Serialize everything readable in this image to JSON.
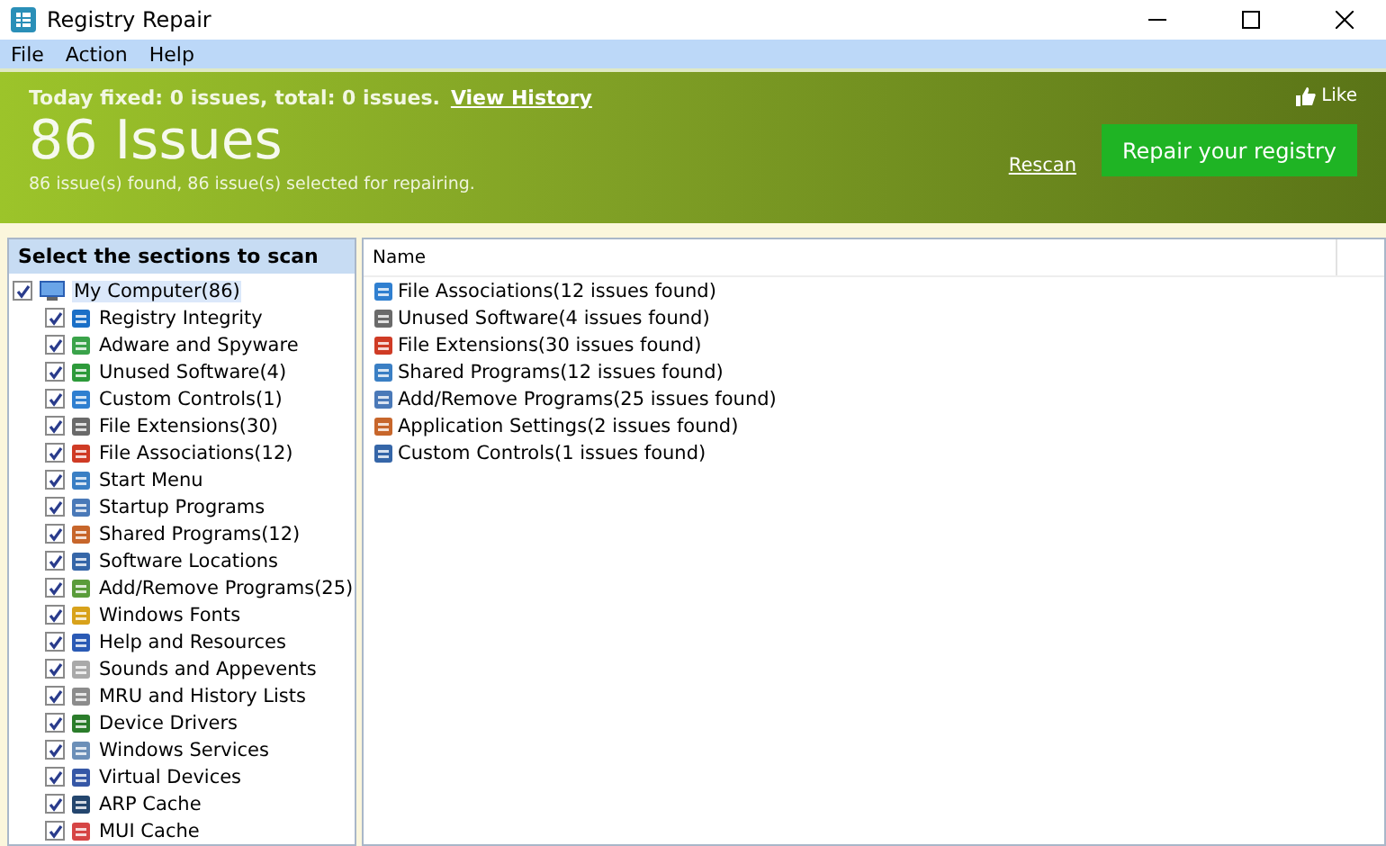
{
  "window": {
    "title": "Registry Repair"
  },
  "menu": [
    "File",
    "Action",
    "Help"
  ],
  "banner": {
    "today": "Today fixed: 0 issues, total: 0 issues.",
    "history_link": "View History",
    "headline": "86 Issues",
    "summary": "86 issue(s) found, 86 issue(s) selected for repairing.",
    "like": "Like",
    "rescan": "Rescan",
    "repair_button": "Repair your registry"
  },
  "sections": {
    "title": "Select the sections to scan",
    "tree": [
      {
        "label": "My Computer(86)",
        "checked": true,
        "selected": true,
        "children": [
          {
            "label": "Registry Integrity",
            "checked": true,
            "selected": false
          },
          {
            "label": "Adware and Spyware",
            "checked": true,
            "selected": false
          },
          {
            "label": "Unused Software(4)",
            "checked": true,
            "selected": false
          },
          {
            "label": "Custom Controls(1)",
            "checked": true,
            "selected": false
          },
          {
            "label": "File Extensions(30)",
            "checked": true,
            "selected": false
          },
          {
            "label": "File Associations(12)",
            "checked": true,
            "selected": false
          },
          {
            "label": "Start Menu",
            "checked": true,
            "selected": false
          },
          {
            "label": "Startup Programs",
            "checked": true,
            "selected": false
          },
          {
            "label": "Shared Programs(12)",
            "checked": true,
            "selected": false
          },
          {
            "label": "Software Locations",
            "checked": true,
            "selected": false
          },
          {
            "label": "Add/Remove Programs(25)",
            "checked": true,
            "selected": false
          },
          {
            "label": "Windows Fonts",
            "checked": true,
            "selected": false
          },
          {
            "label": "Help and Resources",
            "checked": true,
            "selected": false
          },
          {
            "label": "Sounds and Appevents",
            "checked": true,
            "selected": false
          },
          {
            "label": "MRU and History Lists",
            "checked": true,
            "selected": false
          },
          {
            "label": "Device Drivers",
            "checked": true,
            "selected": false
          },
          {
            "label": "Windows Services",
            "checked": true,
            "selected": false
          },
          {
            "label": "Virtual Devices",
            "checked": true,
            "selected": false
          },
          {
            "label": "ARP Cache",
            "checked": true,
            "selected": false
          },
          {
            "label": "MUI Cache",
            "checked": true,
            "selected": false
          }
        ]
      }
    ]
  },
  "results": {
    "columns": [
      "Name"
    ],
    "rows": [
      "File Associations(12 issues found)",
      "Unused Software(4 issues found)",
      "File Extensions(30 issues found)",
      "Shared Programs(12 issues found)",
      "Add/Remove Programs(25 issues found)",
      "Application Settings(2 issues found)",
      "Custom Controls(1 issues found)"
    ]
  }
}
